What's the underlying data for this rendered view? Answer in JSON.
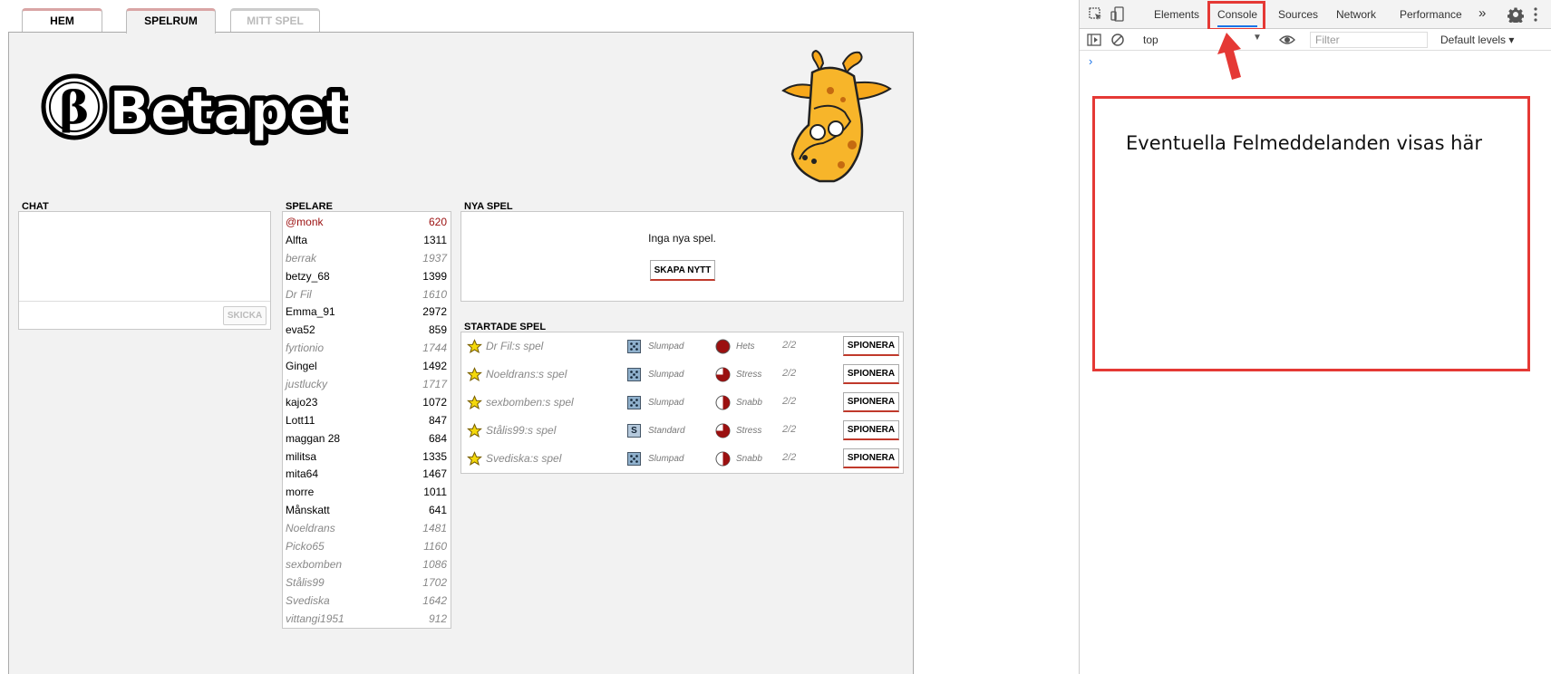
{
  "app": {
    "tabs": [
      {
        "label": "HEM"
      },
      {
        "label": "SPELRUM"
      },
      {
        "label": "MITT SPEL"
      }
    ],
    "logo_text": "Betapet",
    "logo_symbol": "β",
    "chat": {
      "title": "CHAT",
      "send_label": "SKICKA"
    },
    "players": {
      "title": "SPELARE",
      "list": [
        {
          "name": "@monk",
          "score": "620"
        },
        {
          "name": "Alfta",
          "score": "1311"
        },
        {
          "name": "berrak",
          "score": "1937"
        },
        {
          "name": "betzy_68",
          "score": "1399"
        },
        {
          "name": "Dr Fil",
          "score": "1610"
        },
        {
          "name": "Emma_91",
          "score": "2972"
        },
        {
          "name": "eva52",
          "score": "859"
        },
        {
          "name": "fyrtionio",
          "score": "1744"
        },
        {
          "name": "Gingel",
          "score": "1492"
        },
        {
          "name": "justlucky",
          "score": "1717"
        },
        {
          "name": "kajo23",
          "score": "1072"
        },
        {
          "name": "Lott11",
          "score": "847"
        },
        {
          "name": "maggan 28",
          "score": "684"
        },
        {
          "name": "militsa",
          "score": "1335"
        },
        {
          "name": "mita64",
          "score": "1467"
        },
        {
          "name": "morre",
          "score": "1011"
        },
        {
          "name": "Månskatt",
          "score": "641"
        },
        {
          "name": "Noeldrans",
          "score": "1481"
        },
        {
          "name": "Picko65",
          "score": "1160"
        },
        {
          "name": "sexbomben",
          "score": "1086"
        },
        {
          "name": "Stålis99",
          "score": "1702"
        },
        {
          "name": "Svediska",
          "score": "1642"
        },
        {
          "name": "vittangi1951",
          "score": "912"
        }
      ]
    },
    "new_games": {
      "title": "NYA SPEL",
      "empty_text": "Inga nya spel.",
      "create_label": "SKAPA NYTT"
    },
    "started_games": {
      "title": "STARTADE SPEL",
      "games": [
        {
          "name": "Dr Fil:s spel",
          "tiles": "Slumpad",
          "speed": "Hets",
          "players": "2/2",
          "action": "SPIONERA"
        },
        {
          "name": "Noeldrans:s spel",
          "tiles": "Slumpad",
          "speed": "Stress",
          "players": "2/2",
          "action": "SPIONERA"
        },
        {
          "name": "sexbomben:s spel",
          "tiles": "Slumpad",
          "speed": "Snabb",
          "players": "2/2",
          "action": "SPIONERA"
        },
        {
          "name": "Stålis99:s spel",
          "tiles": "Standard",
          "tile_badge": "S",
          "speed": "Stress",
          "players": "2/2",
          "action": "SPIONERA"
        },
        {
          "name": "Svediska:s spel",
          "tiles": "Slumpad",
          "speed": "Snabb",
          "players": "2/2",
          "action": "SPIONERA"
        }
      ]
    }
  },
  "devtools": {
    "tabs": [
      {
        "label": "Elements"
      },
      {
        "label": "Console"
      },
      {
        "label": "Sources"
      },
      {
        "label": "Network"
      },
      {
        "label": "Performance"
      }
    ],
    "more_tabs": "»",
    "context": "top",
    "filter_placeholder": "Filter",
    "levels": "Default levels ▾",
    "prompt": "›",
    "annotation": "Eventuella Felmeddelanden visas här",
    "colors": {
      "highlight": "#e53935",
      "accent": "#1a73e8"
    }
  }
}
